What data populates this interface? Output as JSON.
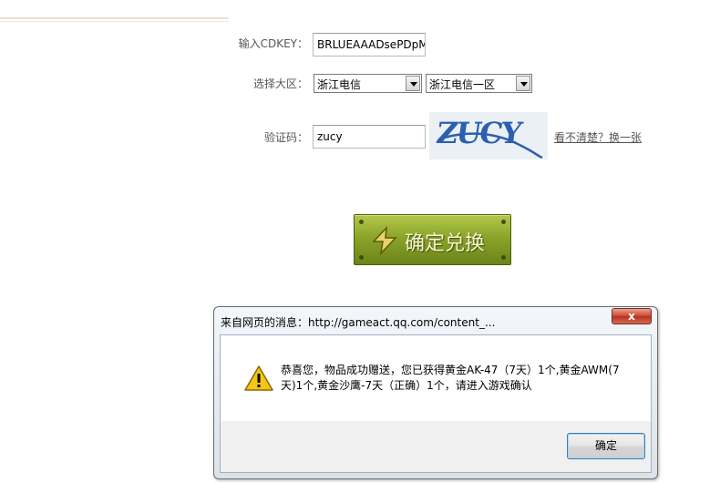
{
  "form": {
    "cdkey_label": "输入CDKEY：",
    "cdkey_value": "BRLUEAAADsePDpMf",
    "region_label": "选择大区：",
    "province_selected": "浙江电信",
    "zone_selected": "浙江电信一区",
    "captcha_label": "验证码：",
    "captcha_value": "zucy",
    "captcha_image_text": "ZUCY",
    "refresh_link": "看不清楚？换一张",
    "redeem_button": "确定兑换"
  },
  "dialog": {
    "title": "来自网页的消息：http://gameact.qq.com/content_...",
    "close_label": "x",
    "message": "恭喜您，物品成功赠送，您已获得黄金AK-47（7天）1个,黄金AWM(7天)1个,黄金沙鹰-7天（正确）1个，请进入游戏确认",
    "ok_button": "确定",
    "icon": "warning-icon"
  },
  "colors": {
    "button_green": "#8ba42a",
    "captcha_blue": "#2d5fb0",
    "close_red": "#c8452f"
  }
}
